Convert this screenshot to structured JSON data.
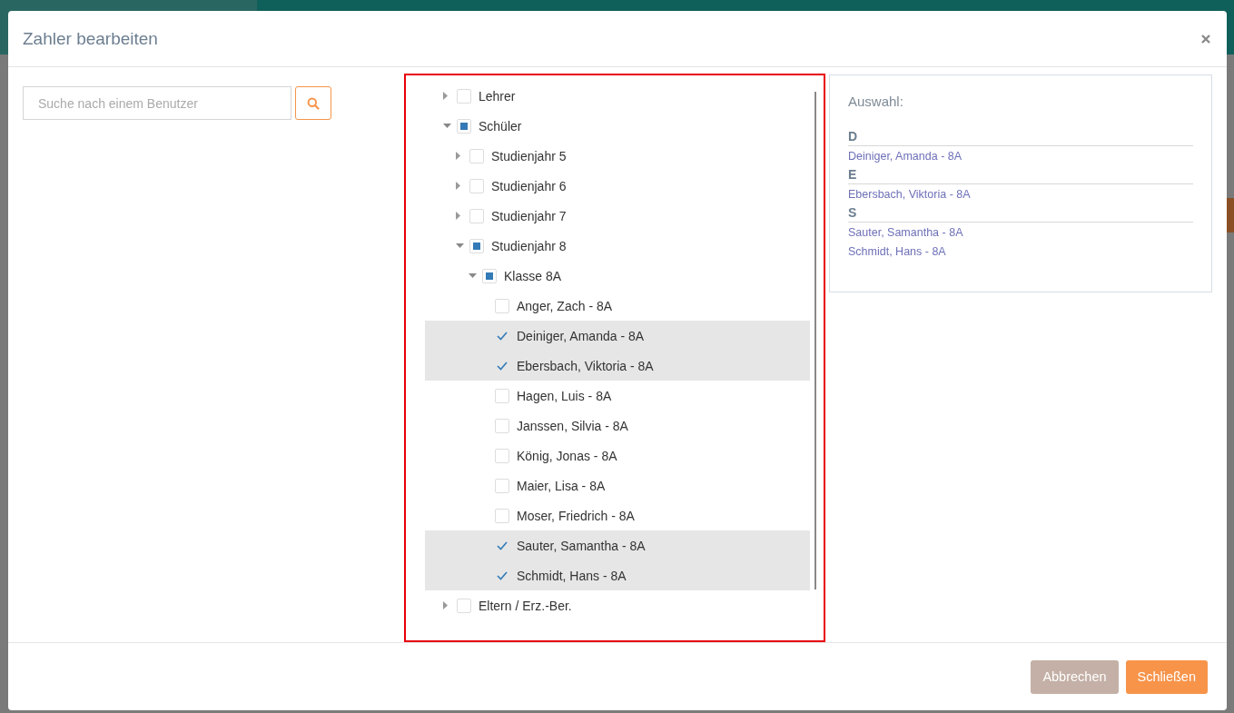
{
  "dialog": {
    "title": "Zahler bearbeiten"
  },
  "search": {
    "placeholder": "Suche nach einem Benutzer"
  },
  "tree": [
    {
      "label": "Lehrer",
      "checked": false,
      "expanded": false
    },
    {
      "label": "Schüler",
      "partial": true,
      "expanded": true,
      "children": [
        {
          "label": "Studienjahr 5",
          "checked": false,
          "expanded": false
        },
        {
          "label": "Studienjahr 6",
          "checked": false,
          "expanded": false
        },
        {
          "label": "Studienjahr 7",
          "checked": false,
          "expanded": false
        },
        {
          "label": "Studienjahr 8",
          "partial": true,
          "expanded": true,
          "children": [
            {
              "label": "Klasse 8A",
              "partial": true,
              "expanded": true,
              "children": [
                {
                  "label": "Anger, Zach - 8A",
                  "checked": false
                },
                {
                  "label": "Deiniger, Amanda - 8A",
                  "checked": true
                },
                {
                  "label": "Ebersbach, Viktoria - 8A",
                  "checked": true
                },
                {
                  "label": "Hagen, Luis - 8A",
                  "checked": false
                },
                {
                  "label": "Janssen, Silvia - 8A",
                  "checked": false
                },
                {
                  "label": "König, Jonas - 8A",
                  "checked": false
                },
                {
                  "label": "Maier, Lisa - 8A",
                  "checked": false
                },
                {
                  "label": "Moser, Friedrich - 8A",
                  "checked": false
                },
                {
                  "label": "Sauter, Samantha - 8A",
                  "checked": true
                },
                {
                  "label": "Schmidt, Hans - 8A",
                  "checked": true
                }
              ]
            }
          ]
        }
      ]
    },
    {
      "label": "Eltern / Erz.-Ber.",
      "checked": false,
      "expanded": false
    }
  ],
  "selection": {
    "title": "Auswahl:",
    "groups": [
      {
        "letter": "D",
        "names": [
          "Deiniger, Amanda - 8A"
        ]
      },
      {
        "letter": "E",
        "names": [
          "Ebersbach, Viktoria - 8A"
        ]
      },
      {
        "letter": "S",
        "names": [
          "Sauter, Samantha - 8A",
          "Schmidt, Hans - 8A"
        ]
      }
    ]
  },
  "buttons": [
    {
      "label": "Abbrechen",
      "kind": "cancel"
    },
    {
      "label": "Schließen",
      "kind": "primary"
    }
  ]
}
